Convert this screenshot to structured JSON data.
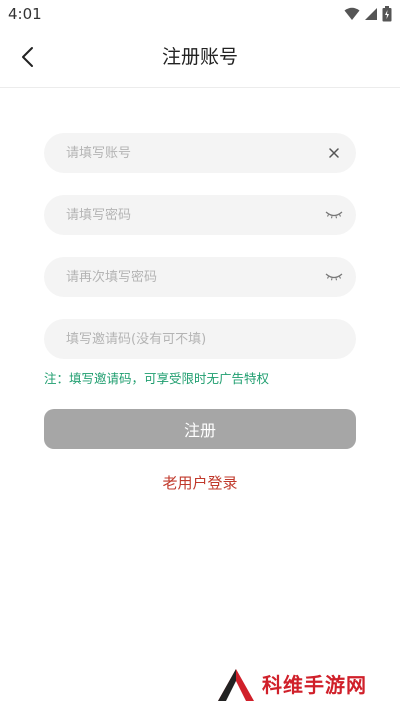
{
  "status_bar": {
    "time": "4:01"
  },
  "header": {
    "title": "注册账号"
  },
  "form": {
    "account": {
      "placeholder": "请填写账号",
      "value": ""
    },
    "password": {
      "placeholder": "请填写密码",
      "value": ""
    },
    "password_confirm": {
      "placeholder": "请再次填写密码",
      "value": ""
    },
    "invite_code": {
      "placeholder": "填写邀请码(没有可不填)",
      "value": ""
    },
    "note": "注：填写邀请码，可享受限时无广告特权",
    "submit_label": "注册"
  },
  "login_link": "老用户登录",
  "watermark": {
    "text": "科维手游网"
  },
  "colors": {
    "note": "#1f9e6f",
    "submit_bg": "#a6a6a6",
    "login_link": "#c0392b",
    "watermark": "#d0202a"
  },
  "icons": {
    "back": "chevron-left-icon",
    "clear": "close-icon",
    "eye_closed": "eye-closed-icon"
  }
}
